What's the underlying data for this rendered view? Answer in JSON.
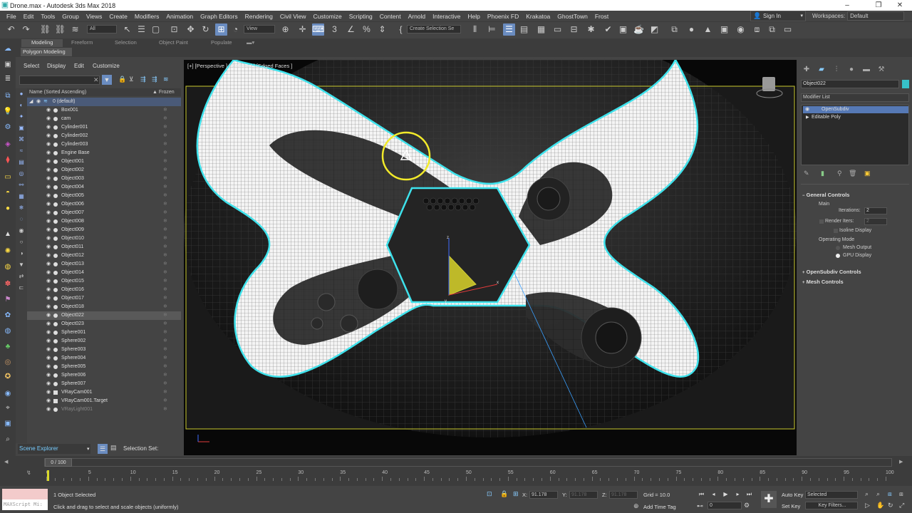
{
  "window": {
    "title": "Drone.max - Autodesk 3ds Max 2018"
  },
  "menu": [
    "File",
    "Edit",
    "Tools",
    "Group",
    "Views",
    "Create",
    "Modifiers",
    "Animation",
    "Graph Editors",
    "Rendering",
    "Civil View",
    "Customize",
    "Scripting",
    "Content",
    "Arnold",
    "Interactive",
    "Help",
    "Phoenix FD",
    "Krakatoa",
    "GhostTown",
    "Frost"
  ],
  "account": {
    "signin": "Sign In",
    "workspace_label": "Workspaces:",
    "workspace_value": "Default"
  },
  "toolbar": {
    "filter_value": "All",
    "refcoord_value": "View",
    "selection_set_placeholder": "Create Selection Se"
  },
  "ribbon": {
    "tabs": [
      "Modeling",
      "Freeform",
      "Selection",
      "Object Paint",
      "Populate"
    ],
    "active_tab": "Modeling",
    "panel": "Polygon Modeling"
  },
  "scene_explorer": {
    "menu": [
      "Select",
      "Display",
      "Edit",
      "Customize"
    ],
    "col_name": "Name (Sorted Ascending)",
    "col_frozen": "▲ Frozen",
    "root": "0 (default)",
    "items": [
      "Box001",
      "cam",
      "Cylinder001",
      "Cylinder002",
      "Cylinder003",
      "Engine Base",
      "Object001",
      "Object002",
      "Object003",
      "Object004",
      "Object005",
      "Object006",
      "Object007",
      "Object008",
      "Object009",
      "Object010",
      "Object011",
      "Object012",
      "Object013",
      "Object014",
      "Object015",
      "Object016",
      "Object017",
      "Object018",
      "Object022",
      "Object023",
      "Sphere001",
      "Sphere002",
      "Sphere003",
      "Sphere004",
      "Sphere005",
      "Sphere006",
      "Sphere007",
      "VRayCam001",
      "VRayCam001.Target",
      "VRayLight001"
    ],
    "selected_item": "Object022",
    "dropdown_value": "Scene Explorer",
    "selection_set_label": "Selection Set:"
  },
  "viewport": {
    "label": "[+] [Perspective ] [Standard ] [Edged Faces ]",
    "axis_x": "x",
    "axis_y": "y",
    "axis_z": "z"
  },
  "command_panel": {
    "object_name": "Object022",
    "object_color": "#37c1c9",
    "modifier_list_label": "Modifier List",
    "stack": [
      "OpenSubdiv",
      "Editable Poly"
    ],
    "selected_modifier": "OpenSubdiv",
    "rollouts": {
      "general": "General Controls",
      "main": "Main",
      "iterations_label": "Iterations:",
      "iterations_value": "2",
      "render_iters_label": "Render Iters:",
      "render_iters_value": "2",
      "isoline_label": "Isoline Display",
      "operating_mode_label": "Operating Mode",
      "mesh_output_label": "Mesh Output",
      "gpu_display_label": "GPU Display",
      "opensubdiv_controls": "OpenSubdiv Controls",
      "mesh_controls": "Mesh Controls"
    }
  },
  "timeline": {
    "frame_display": "0 / 100",
    "current_frame": 0,
    "total_frames": 100,
    "ticks": [
      "0",
      "5",
      "10",
      "15",
      "20",
      "25",
      "30",
      "35",
      "40",
      "45",
      "50",
      "55",
      "60",
      "65",
      "70",
      "75",
      "80",
      "85",
      "90",
      "95",
      "100"
    ]
  },
  "status": {
    "maxscript": "MAXScript Mi:",
    "selected": "1 Object Selected",
    "prompt": "Click and drag to select and scale objects (uniformly)",
    "x_label": "X:",
    "x_value": "91.178",
    "y_label": "Y:",
    "y_value": "91.178",
    "z_label": "Z:",
    "z_value": "91.178",
    "grid": "Grid = 10.0",
    "add_time_tag": "Add Time Tag",
    "frame_field": "0",
    "auto_key": "Auto Key",
    "set_key": "Set Key",
    "key_mode": "Selected",
    "key_filters": "Key Filters..."
  }
}
